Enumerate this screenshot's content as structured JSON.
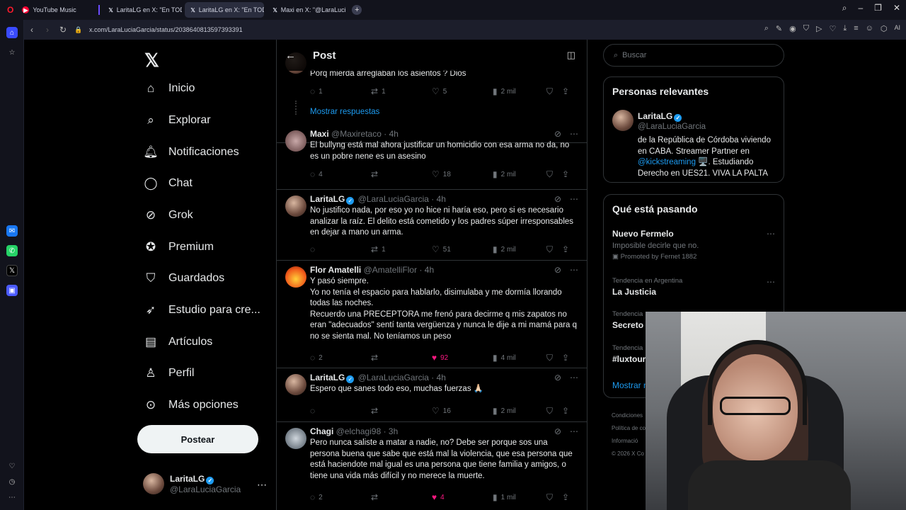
{
  "browser": {
    "tabs": [
      {
        "label": "YouTube Music",
        "icon": "youtube-icon",
        "color": "#ff0033"
      },
      {
        "label": "LaritaLG en X: \"En TODAS",
        "icon": "x-icon",
        "color": "#ffffff"
      },
      {
        "label": "LaritaLG en X: \"En TODAS",
        "icon": "x-icon",
        "color": "#ffffff"
      },
      {
        "label": "Maxi en X: \"@LaraLuciaG",
        "icon": "x-icon",
        "color": "#ffffff"
      }
    ],
    "url": "x.com/LaraLuciaGarcia/status/2038640813597393391",
    "ai_label": "AI"
  },
  "nav": {
    "items": [
      "Inicio",
      "Explorar",
      "Notificaciones",
      "Chat",
      "Grok",
      "Premium",
      "Guardados",
      "Estudio para cre...",
      "Artículos",
      "Perfil",
      "Más opciones"
    ],
    "post_button": "Postear",
    "me": {
      "name": "LaritaLG",
      "handle": "@LaraLuciaGarcia"
    }
  },
  "main": {
    "title": "Post",
    "replies": [
      {
        "name": "",
        "handle": "",
        "time": "",
        "text": "Porq mierda arreglaban los asientos ? Dios",
        "counts": {
          "reply": "1",
          "retweet": "1",
          "like": "5",
          "views": "2 mil"
        },
        "show_replies": "Mostrar respuestas"
      },
      {
        "name": "Maxi",
        "handle": "@Maxiretaco",
        "time": "· 4h",
        "text": "El bullyng está mal ahora justificar un homicidio con esa arma no da, no es un pobre nene es un asesino",
        "counts": {
          "reply": "4",
          "retweet": "",
          "like": "18",
          "views": "2 mil"
        }
      },
      {
        "name": "LaritaLG",
        "handle": "@LaraLuciaGarcia",
        "time": "· 4h",
        "text": "No justifico nada, por eso yo no hice ni haría eso, pero si es necesario analizar la raíz. El delito está cometido y los padres súper irresponsables en dejar a mano un arma.",
        "counts": {
          "reply": "",
          "retweet": "1",
          "like": "51",
          "views": "2 mil"
        }
      },
      {
        "name": "Flor Amatelli",
        "handle": "@AmatelliFlor",
        "time": "· 4h",
        "text": "Y pasó siempre.\nYo no tenía el espacio para hablarlo, disimulaba y me dormía llorando todas las noches.\nRecuerdo una PRECEPTORA me frenó para decirme q mis zapatos no eran \"adecuados\" sentí tanta vergüenza y nunca le dije a mi mamá para q no se sienta mal. No teníamos un peso",
        "counts": {
          "reply": "2",
          "retweet": "",
          "like": "92",
          "views": "4 mil"
        }
      },
      {
        "name": "LaritaLG",
        "handle": "@LaraLuciaGarcia",
        "time": "· 4h",
        "text": "Espero que sanes todo eso, muchas fuerzas 🙏🏻",
        "counts": {
          "reply": "",
          "retweet": "",
          "like": "16",
          "views": "2 mil"
        }
      },
      {
        "name": "Chagi",
        "handle": "@elchagi98",
        "time": "· 3h",
        "text": "Pero nunca saliste a matar a nadie, no? Debe ser porque sos una persona buena que sabe que está mal la violencia, que esa persona que está haciendote mal igual es una persona que tiene familia y amigos, o tiene una vida más difícil y no merece la muerte.",
        "counts": {
          "reply": "2",
          "retweet": "",
          "like": "4",
          "views": "1 mil"
        }
      }
    ]
  },
  "right": {
    "search_placeholder": "Buscar",
    "relevant_title": "Personas relevantes",
    "relevant": {
      "name": "LaritaLG",
      "handle": "@LaraLuciaGarcia",
      "bio_1": "de la República de Córdoba viviendo en CABA. Streamer Partner en ",
      "bio_link": "@kickstreaming",
      "bio_2": " 🖥️. Estudiando Derecho en UES21. VIVA LA PALTA"
    },
    "trends_title": "Qué está pasando",
    "trends": [
      {
        "meta": "",
        "name": "Nuevo Fermelo",
        "sub": "Imposible decirle que no.",
        "promo": "Promoted by Fernet 1882"
      },
      {
        "meta": "Tendencia en Argentina",
        "name": "La Justicia",
        "sub": "",
        "promo": ""
      },
      {
        "meta": "Tendencia",
        "name": "Secreto",
        "sub": "",
        "promo": ""
      },
      {
        "meta": "Tendencia",
        "name": "#luxtour",
        "sub": "",
        "promo": ""
      }
    ],
    "show_more": "Mostrar m",
    "footer": [
      "Condiciones",
      "Política de co",
      "Informació",
      "© 2026 X Co"
    ]
  }
}
